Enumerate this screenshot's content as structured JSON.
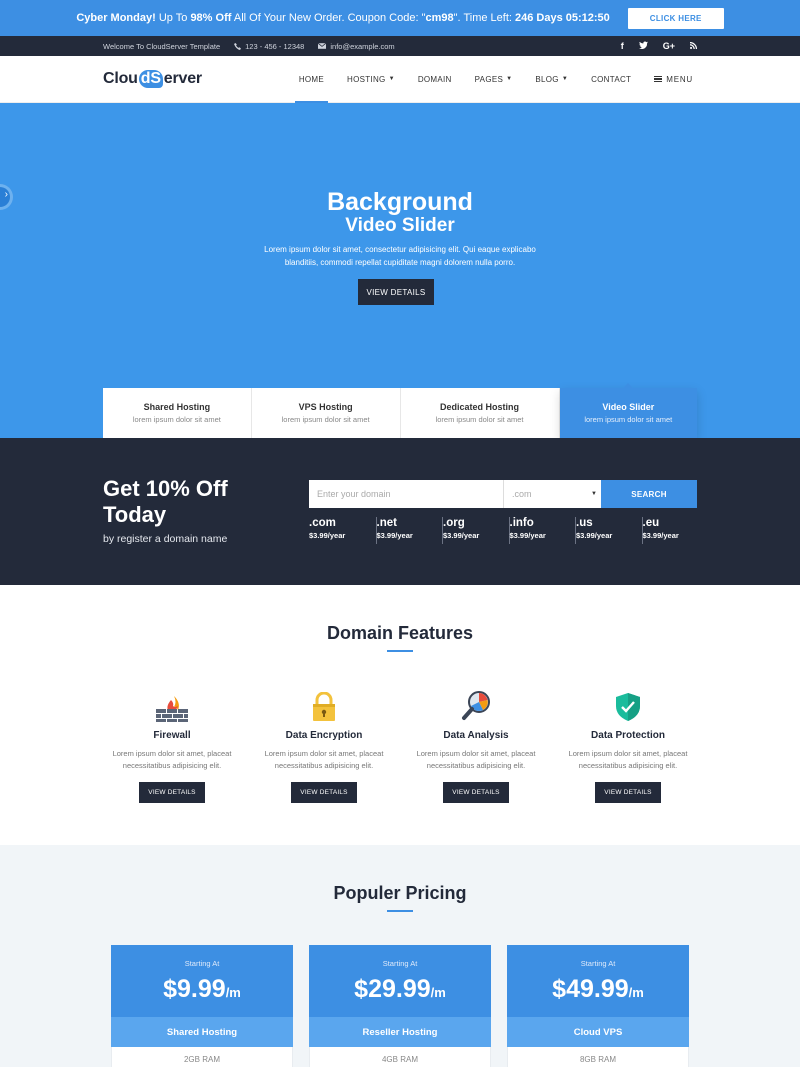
{
  "promo": {
    "label": "Cyber Monday!",
    "text1": " Up To ",
    "discount": "98% Off",
    "text2": " All Of Your New Order. Coupon Code: \"",
    "code": "cm98",
    "text3": "\". Time Left: ",
    "time_left": "246 Days 05:12:50",
    "button": "CLICK HERE"
  },
  "topbar": {
    "welcome": "Welcome To CloudServer Template",
    "phone": "123 - 456 - 12348",
    "email": "info@example.com"
  },
  "nav": {
    "logo_part1": "Clou",
    "logo_bubble": "dS",
    "logo_part2": "erver",
    "items": [
      {
        "label": "HOME",
        "active": true
      },
      {
        "label": "HOSTING"
      },
      {
        "label": "DOMAIN"
      },
      {
        "label": "PAGES"
      },
      {
        "label": "BLOG"
      },
      {
        "label": "CONTACT"
      },
      {
        "label": "MENU"
      }
    ]
  },
  "hero": {
    "title": "Background",
    "subtitle": "Video Slider",
    "text": "Lorem ipsum dolor sit amet, consectetur adipisicing elit. Qui eaque explicabo blanditiis, commodi repellat cupiditate magni dolorem nulla porro.",
    "cta": "VIEW DETAILS",
    "tabs": [
      {
        "title": "Shared Hosting",
        "sub": "lorem ipsum dolor sit amet"
      },
      {
        "title": "VPS Hosting",
        "sub": "lorem ipsum dolor sit amet"
      },
      {
        "title": "Dedicated Hosting",
        "sub": "lorem ipsum dolor sit amet"
      },
      {
        "title": "Video Slider",
        "sub": "lorem ipsum dolor sit amet"
      }
    ]
  },
  "domain": {
    "heading": "Get 10% Off Today",
    "sub": "by register a domain name",
    "placeholder": "Enter your domain",
    "select": ".com",
    "search": "SEARCH",
    "tlds": [
      {
        "name": ".com",
        "price": "$3.99/year"
      },
      {
        "name": ".net",
        "price": "$3.99/year"
      },
      {
        "name": ".org",
        "price": "$3.99/year"
      },
      {
        "name": ".info",
        "price": "$3.99/year"
      },
      {
        "name": ".us",
        "price": "$3.99/year"
      },
      {
        "name": ".eu",
        "price": "$3.99/year"
      }
    ]
  },
  "features": {
    "title": "Domain Features",
    "items": [
      {
        "title": "Firewall",
        "text": "Lorem ipsum dolor sit amet, placeat necessitatibus adipisicing elit.",
        "button": "VIEW DETAILS"
      },
      {
        "title": "Data Encryption",
        "text": "Lorem ipsum dolor sit amet, placeat necessitatibus adipisicing elit.",
        "button": "VIEW DETAILS"
      },
      {
        "title": "Data Analysis",
        "text": "Lorem ipsum dolor sit amet, placeat necessitatibus adipisicing elit.",
        "button": "VIEW DETAILS"
      },
      {
        "title": "Data Protection",
        "text": "Lorem ipsum dolor sit amet, placeat necessitatibus adipisicing elit.",
        "button": "VIEW DETAILS"
      }
    ]
  },
  "pricing": {
    "title": "Populer Pricing",
    "plans": [
      {
        "starting": "Starting At",
        "price": "$9.99",
        "per": "/m",
        "name": "Shared Hosting",
        "feature": "2GB RAM"
      },
      {
        "starting": "Starting At",
        "price": "$29.99",
        "per": "/m",
        "name": "Reseller Hosting",
        "feature": "4GB RAM"
      },
      {
        "starting": "Starting At",
        "price": "$49.99",
        "per": "/m",
        "name": "Cloud VPS",
        "feature": "8GB RAM"
      }
    ]
  },
  "colors": {
    "primary": "#3d8fe3",
    "dark": "#232a3a",
    "hero": "#3d97ea"
  }
}
